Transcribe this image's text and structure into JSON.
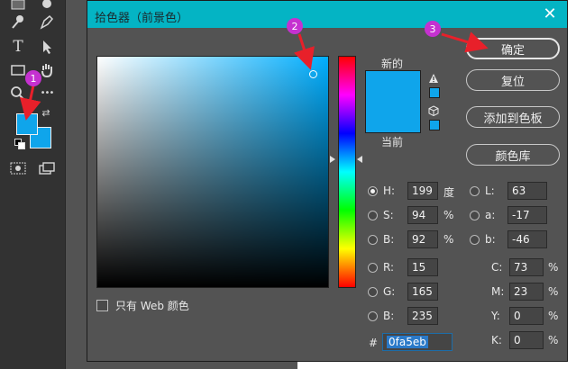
{
  "dialog": {
    "title": "拾色器（前景色）",
    "close_glyph": "✕",
    "new_label": "新的",
    "current_label": "当前",
    "web_only_label": "只有 Web 颜色",
    "buttons": {
      "ok": "确定",
      "reset": "复位",
      "add_to_swatches": "添加到色板",
      "color_libraries": "颜色库"
    },
    "fields": {
      "H": {
        "label": "H:",
        "value": "199",
        "unit": "度"
      },
      "S": {
        "label": "S:",
        "value": "94",
        "unit": "%"
      },
      "Bv": {
        "label": "B:",
        "value": "92",
        "unit": "%"
      },
      "R": {
        "label": "R:",
        "value": "15"
      },
      "G": {
        "label": "G:",
        "value": "165"
      },
      "Bc": {
        "label": "B:",
        "value": "235"
      },
      "L": {
        "label": "L:",
        "value": "63"
      },
      "a": {
        "label": "a:",
        "value": "-17"
      },
      "b": {
        "label": "b:",
        "value": "-46"
      },
      "C": {
        "label": "C:",
        "value": "73",
        "unit": "%"
      },
      "M": {
        "label": "M:",
        "value": "23",
        "unit": "%"
      },
      "Y": {
        "label": "Y:",
        "value": "0",
        "unit": "%"
      },
      "K": {
        "label": "K:",
        "value": "0",
        "unit": "%"
      },
      "hex": {
        "label": "#",
        "value": "0fa5eb"
      }
    },
    "selected_radio": "H"
  },
  "annotations": [
    "1",
    "2",
    "3"
  ],
  "colors": {
    "selected": "#0fa5eb",
    "titlebar": "#04b4c4",
    "annotation": "#c531d0",
    "arrow": "#e8202a"
  },
  "toolbar": {
    "icons": [
      "brush-icon",
      "stamp-icon",
      "pen-icon",
      "type-icon",
      "path-select-icon",
      "rectangle-icon",
      "hand-icon",
      "zoom-icon",
      "more-icon",
      "swap-icon",
      "default-colors-icon",
      "quick-mask-icon",
      "screen-mode-icon"
    ],
    "type_glyph": "T",
    "more_glyph": "•••",
    "swap_glyph": "⇄"
  }
}
